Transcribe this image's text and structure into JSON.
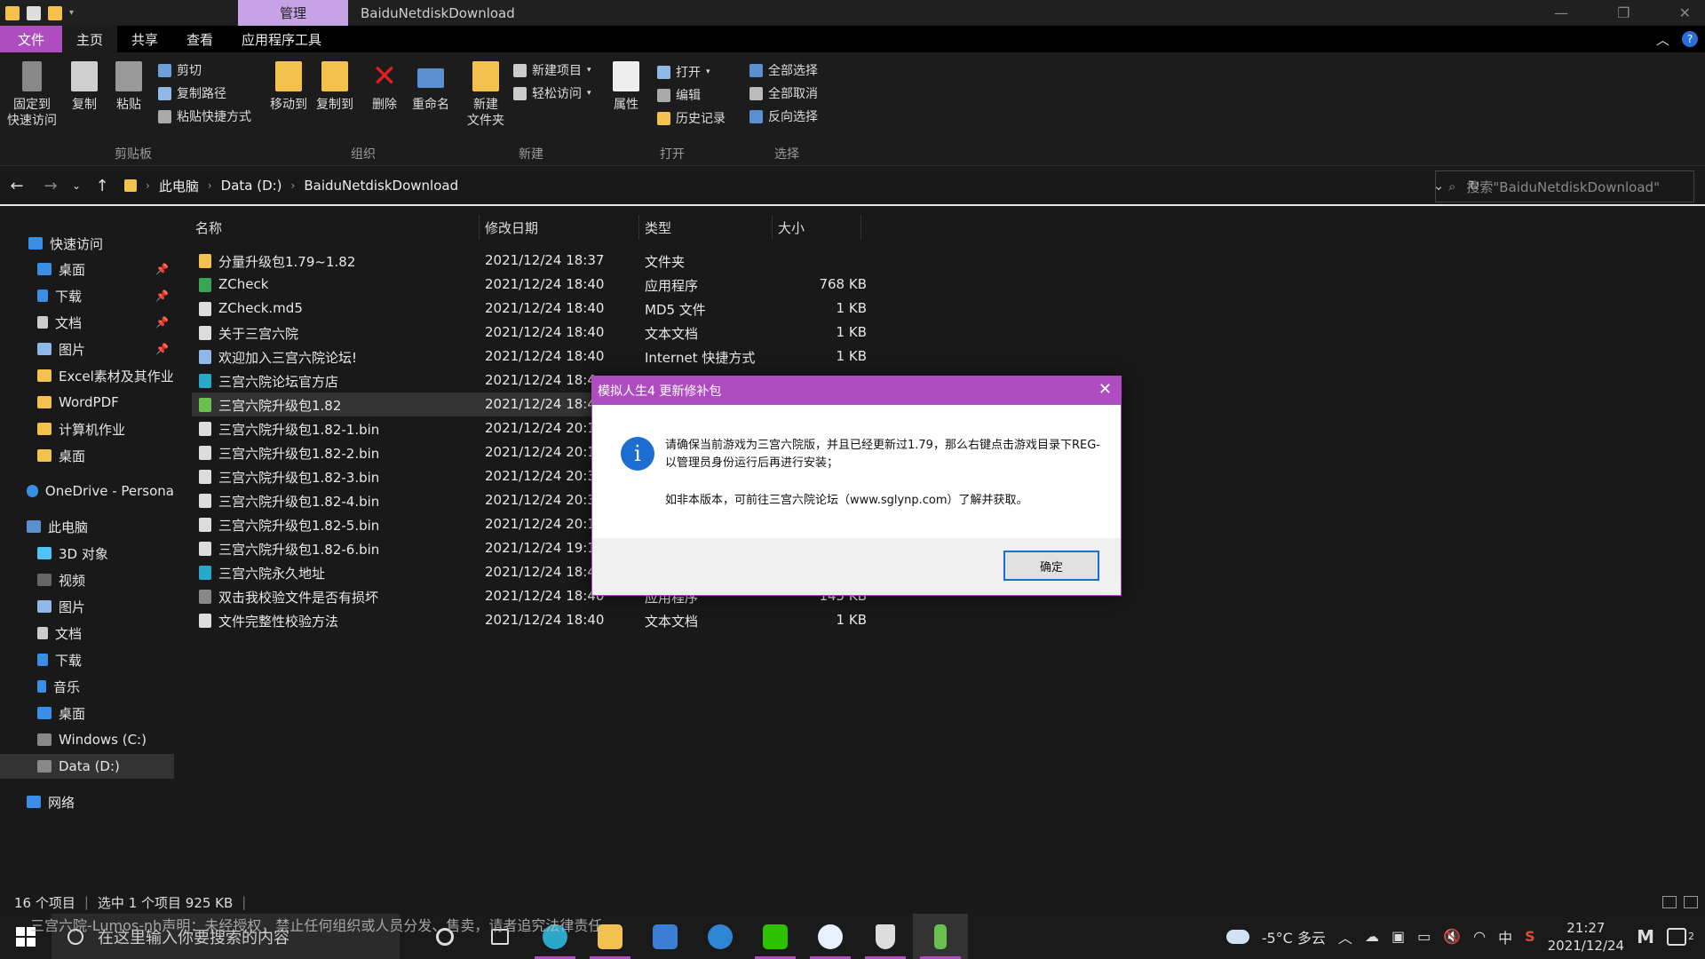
{
  "titlebar": {
    "manage_tab": "管理",
    "window_title": "BaiduNetdiskDownload"
  },
  "ribbon_tabs": [
    "文件",
    "主页",
    "共享",
    "查看",
    "应用程序工具"
  ],
  "ribbon": {
    "clipboard": {
      "pin": "固定到\n快速访问",
      "pin_l1": "固定到",
      "pin_l2": "快速访问",
      "copy": "复制",
      "paste": "粘贴",
      "cut": "剪切",
      "copy_path": "复制路径",
      "paste_shortcut": "粘贴快捷方式",
      "label": "剪贴板"
    },
    "organize": {
      "move_to": "移动到",
      "copy_to": "复制到",
      "delete": "删除",
      "rename": "重命名",
      "label": "组织"
    },
    "new": {
      "new_folder_l1": "新建",
      "new_folder_l2": "文件夹",
      "new_item": "新建项目",
      "easy_access": "轻松访问",
      "label": "新建"
    },
    "open": {
      "properties": "属性",
      "open": "打开",
      "edit": "编辑",
      "history": "历史记录",
      "label": "打开"
    },
    "select": {
      "select_all": "全部选择",
      "select_none": "全部取消",
      "invert": "反向选择",
      "label": "选择"
    }
  },
  "address": {
    "crumbs": [
      "此电脑",
      "Data (D:)",
      "BaiduNetdiskDownload"
    ],
    "search_placeholder": "搜索\"BaiduNetdiskDownload\""
  },
  "nav": {
    "quick_access": "快速访问",
    "qa_items": [
      "桌面",
      "下载",
      "文档",
      "图片",
      "Excel素材及其作业",
      "WordPDF",
      "计算机作业",
      "桌面"
    ],
    "onedrive": "OneDrive - Persona",
    "this_pc": "此电脑",
    "pc_items": [
      "3D 对象",
      "视频",
      "图片",
      "文档",
      "下载",
      "音乐",
      "桌面",
      "Windows (C:)",
      "Data (D:)"
    ],
    "network": "网络"
  },
  "columns": {
    "name": "名称",
    "date": "修改日期",
    "type": "类型",
    "size": "大小"
  },
  "files": [
    {
      "name": "分量升级包1.79~1.82",
      "date": "2021/12/24 18:37",
      "type": "文件夹",
      "size": "",
      "icon": "folder-icon",
      "color": "#f2c14e"
    },
    {
      "name": "ZCheck",
      "date": "2021/12/24 18:40",
      "type": "应用程序",
      "size": "768 KB",
      "icon": "app-icon",
      "color": "#3aa655"
    },
    {
      "name": "ZCheck.md5",
      "date": "2021/12/24 18:40",
      "type": "MD5 文件",
      "size": "1 KB",
      "icon": "file-icon",
      "color": "#dddddd"
    },
    {
      "name": "关于三宫六院",
      "date": "2021/12/24 18:40",
      "type": "文本文档",
      "size": "1 KB",
      "icon": "text-file-icon",
      "color": "#dddddd"
    },
    {
      "name": "欢迎加入三宫六院论坛!",
      "date": "2021/12/24 18:40",
      "type": "Internet 快捷方式",
      "size": "1 KB",
      "icon": "shortcut-icon",
      "color": "#8fb8e8"
    },
    {
      "name": "三宫六院论坛官方店",
      "date": "2021/12/24 18:4",
      "type": "",
      "size": "",
      "icon": "edge-icon",
      "color": "#2aa7c9"
    },
    {
      "name": "三宫六院升级包1.82",
      "date": "2021/12/24 18:4",
      "type": "",
      "size": "",
      "icon": "installer-icon",
      "color": "#6bbf4e"
    },
    {
      "name": "三宫六院升级包1.82-1.bin",
      "date": "2021/12/24 20:1",
      "type": "",
      "size": "",
      "icon": "file-icon",
      "color": "#dddddd"
    },
    {
      "name": "三宫六院升级包1.82-2.bin",
      "date": "2021/12/24 20:1",
      "type": "",
      "size": "",
      "icon": "file-icon",
      "color": "#dddddd"
    },
    {
      "name": "三宫六院升级包1.82-3.bin",
      "date": "2021/12/24 20:3",
      "type": "",
      "size": "",
      "icon": "file-icon",
      "color": "#dddddd"
    },
    {
      "name": "三宫六院升级包1.82-4.bin",
      "date": "2021/12/24 20:3",
      "type": "",
      "size": "",
      "icon": "file-icon",
      "color": "#dddddd"
    },
    {
      "name": "三宫六院升级包1.82-5.bin",
      "date": "2021/12/24 20:1",
      "type": "",
      "size": "",
      "icon": "file-icon",
      "color": "#dddddd"
    },
    {
      "name": "三宫六院升级包1.82-6.bin",
      "date": "2021/12/24 19:1",
      "type": "",
      "size": "",
      "icon": "file-icon",
      "color": "#dddddd"
    },
    {
      "name": "三宫六院永久地址",
      "date": "2021/12/24 18:4",
      "type": "",
      "size": "",
      "icon": "edge-icon",
      "color": "#2aa7c9"
    },
    {
      "name": "双击我校验文件是否有损坏",
      "date": "2021/12/24 18:40",
      "type": "应用程序",
      "size": "145 KB",
      "icon": "app-icon",
      "color": "#888888"
    },
    {
      "name": "文件完整性校验方法",
      "date": "2021/12/24 18:40",
      "type": "文本文档",
      "size": "1 KB",
      "icon": "text-file-icon",
      "color": "#dddddd"
    }
  ],
  "selected_index": 6,
  "dialog": {
    "title": "模拟人生4 更新修补包",
    "message": "请确保当前游戏为三宫六院版，并且已经更新过1.79，那么右键点击游戏目录下REG-以管理员身份运行后再进行安装；",
    "message2": "如非本版本，可前往三宫六院论坛（www.sglynp.com）了解并获取。",
    "ok": "确定"
  },
  "status": {
    "count": "16 个项目",
    "selection": "选中 1 个项目  925 KB"
  },
  "taskbar": {
    "search_placeholder": "在这里输入你要搜索的内容",
    "weather": "-5°C 多云",
    "ime": "中",
    "time": "21:27",
    "date": "2021/12/24",
    "notif_count": "2"
  },
  "watermark_text": "三宫六院-Lumos-nh声明：未经授权，禁止任何组织或人员分发、售卖，请者追究法律责任",
  "colors": {
    "accent": "#b04cc2",
    "manage_tab": "#c7a2e6",
    "info_blue": "#1c6fd0"
  }
}
